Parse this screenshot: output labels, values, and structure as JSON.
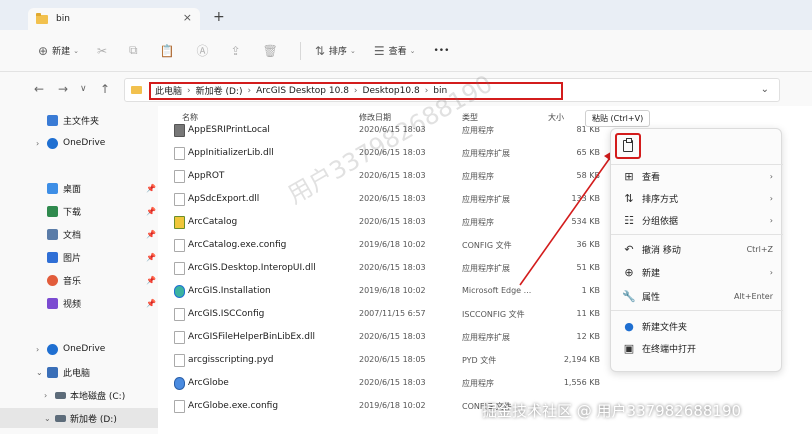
{
  "tab": {
    "title": "bin",
    "close": "×",
    "new": "+"
  },
  "toolbar": {
    "new": "新建",
    "sort": "排序",
    "view": "查看",
    "more": "•••"
  },
  "address": {
    "crumbs": [
      "此电脑",
      "新加卷 (D:)",
      "ArcGIS Desktop 10.8",
      "Desktop10.8",
      "bin"
    ],
    "separator": "›"
  },
  "sidebar": {
    "items": [
      {
        "label": "主文件夹",
        "icon": "home-icon",
        "color": "#3a7bd5"
      },
      {
        "label": "OneDrive",
        "icon": "cloud-icon",
        "color": "#1f6fd1"
      },
      {
        "label": "桌面",
        "icon": "desktop-icon",
        "color": "#3d8ee6"
      },
      {
        "label": "下载",
        "icon": "download-icon",
        "color": "#2f8a4e"
      },
      {
        "label": "文档",
        "icon": "document-icon",
        "color": "#5a7ca8"
      },
      {
        "label": "图片",
        "icon": "picture-icon",
        "color": "#2f6fd6"
      },
      {
        "label": "音乐",
        "icon": "music-icon",
        "color": "#e25c3b"
      },
      {
        "label": "视频",
        "icon": "video-icon",
        "color": "#7b4bd1"
      },
      {
        "label": "OneDrive",
        "icon": "cloud-icon",
        "color": "#1f6fd1"
      },
      {
        "label": "此电脑",
        "icon": "pc-icon",
        "color": "#3a6fb8"
      },
      {
        "label": "本地磁盘 (C:)",
        "icon": "drive-icon",
        "color": "#5d6c7a"
      },
      {
        "label": "新加卷 (D:)",
        "icon": "drive-icon",
        "color": "#5d6c7a"
      }
    ]
  },
  "columns": {
    "name": "名称",
    "date": "修改日期",
    "type": "类型",
    "size": "大小"
  },
  "files": [
    {
      "name": "AppESRIPrintLocal",
      "date": "2020/6/15 18:03",
      "type": "应用程序",
      "size": "81 KB"
    },
    {
      "name": "AppInitializerLib.dll",
      "date": "2020/6/15 18:03",
      "type": "应用程序扩展",
      "size": "65 KB"
    },
    {
      "name": "AppROT",
      "date": "2020/6/15 18:03",
      "type": "应用程序",
      "size": "58 KB"
    },
    {
      "name": "ApSdcExport.dll",
      "date": "2020/6/15 18:03",
      "type": "应用程序扩展",
      "size": "133 KB"
    },
    {
      "name": "ArcCatalog",
      "date": "2020/6/15 18:03",
      "type": "应用程序",
      "size": "534 KB"
    },
    {
      "name": "ArcCatalog.exe.config",
      "date": "2019/6/18 10:02",
      "type": "CONFIG 文件",
      "size": "36 KB"
    },
    {
      "name": "ArcGIS.Desktop.InteropUI.dll",
      "date": "2020/6/15 18:03",
      "type": "应用程序扩展",
      "size": "51 KB"
    },
    {
      "name": "ArcGIS.Installation",
      "date": "2019/6/18 10:02",
      "type": "Microsoft Edge ...",
      "size": "1 KB"
    },
    {
      "name": "ArcGIS.ISCConfig",
      "date": "2007/11/15 6:57",
      "type": "ISCCONFIG 文件",
      "size": "11 KB"
    },
    {
      "name": "ArcGISFileHelperBinLibEx.dll",
      "date": "2020/6/15 18:03",
      "type": "应用程序扩展",
      "size": "12 KB"
    },
    {
      "name": "arcgisscripting.pyd",
      "date": "2020/6/15 18:05",
      "type": "PYD 文件",
      "size": "2,194 KB"
    },
    {
      "name": "ArcGlobe",
      "date": "2020/6/15 18:03",
      "type": "应用程序",
      "size": "1,556 KB"
    },
    {
      "name": "ArcGlobe.exe.config",
      "date": "2019/6/18 10:02",
      "type": "CONFIG 文件",
      "size": ""
    }
  ],
  "tooltip": "粘贴 (Ctrl+V)",
  "context_menu": {
    "items": [
      {
        "label": "查看",
        "icon": "grid-icon",
        "accel": "›"
      },
      {
        "label": "排序方式",
        "icon": "sort-icon",
        "accel": "›"
      },
      {
        "label": "分组依据",
        "icon": "group-icon",
        "accel": "›"
      },
      {
        "label": "撤消 移动",
        "icon": "undo-icon",
        "accel": "Ctrl+Z"
      },
      {
        "label": "新建",
        "icon": "new-icon",
        "accel": "›"
      },
      {
        "label": "属性",
        "icon": "wrench-icon",
        "accel": "Alt+Enter"
      },
      {
        "label": "新建文件夹",
        "icon": "new-folder-icon",
        "accel": ""
      },
      {
        "label": "在终端中打开",
        "icon": "terminal-icon",
        "accel": ""
      }
    ]
  },
  "watermark": "用户337982688190",
  "credit": "掘金技术社区 @ 用户337982688190",
  "colors": {
    "highlight_red": "#d31c1c",
    "accent_blue": "#1f6fd1",
    "folder_yellow": "#f2c14e"
  }
}
